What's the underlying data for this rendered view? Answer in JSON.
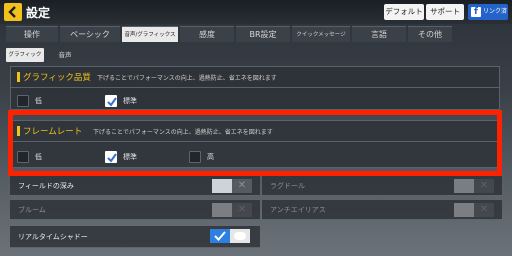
{
  "header": {
    "title": "設定",
    "buttons": {
      "default": "デフォルト",
      "support": "サポート",
      "link": "リンク済"
    }
  },
  "tabs": [
    "操作",
    "ベーシック",
    "音声/グラフィックス",
    "感度",
    "BR設定",
    "クイックメッセージ",
    "言語",
    "その他"
  ],
  "subtabs": [
    "グラフィックス",
    "音声"
  ],
  "graphics_quality": {
    "title": "グラフィック品質",
    "description": "下げることでパフォーマンスの向上、過熱防止、省エネを図れます",
    "options": [
      {
        "label": "低",
        "checked": false
      },
      {
        "label": "標準",
        "checked": true
      }
    ]
  },
  "frame_rate": {
    "title": "フレームレート",
    "description": "下げることでパフォーマンスの向上、過熱防止、省エネを図れます",
    "options": [
      {
        "label": "低",
        "checked": false
      },
      {
        "label": "標準",
        "checked": true
      },
      {
        "label": "高",
        "checked": false
      }
    ]
  },
  "toggles": [
    {
      "label": "フィールドの深み",
      "state": "off"
    },
    {
      "label": "ラグドール",
      "state": "off",
      "disabled": true
    },
    {
      "label": "ブルーム",
      "state": "off",
      "disabled": true
    },
    {
      "label": "アンチエイリアス",
      "state": "off",
      "disabled": true
    },
    {
      "label": "リアルタイムシャドー",
      "state": "on"
    }
  ],
  "colors": {
    "accent": "#f2c11c",
    "highlight": "#ff2200",
    "link": "#2463c9",
    "toggle_on": "#2d7fe0"
  }
}
